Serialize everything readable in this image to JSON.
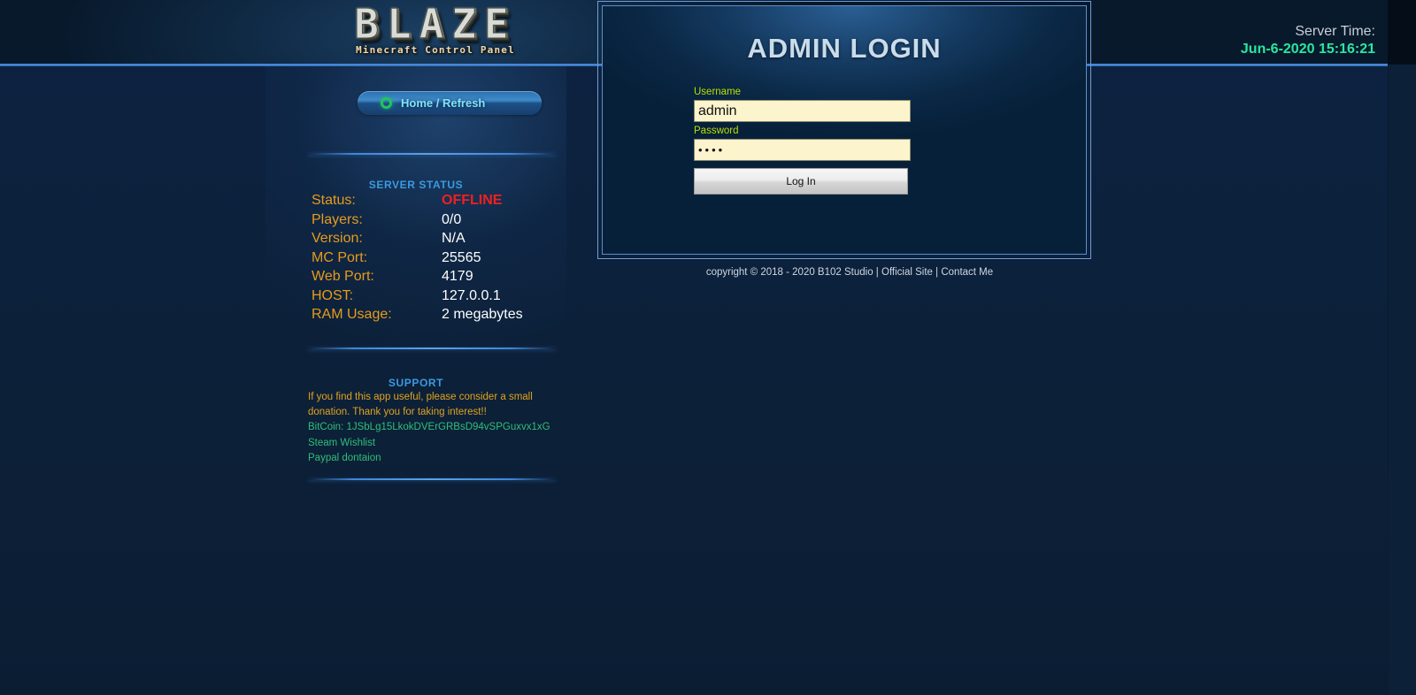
{
  "brand": {
    "logo_word": "BLAZE",
    "logo_subtitle": "Minecraft Control Panel"
  },
  "header": {
    "server_time_label": "Server Time:",
    "server_time_value": "Jun-6-2020 15:16:21"
  },
  "sidebar": {
    "nav": [
      {
        "label": "Home / Refresh",
        "icon": "green-ring-icon"
      }
    ],
    "status_section": {
      "title": "SERVER STATUS",
      "rows": [
        {
          "key": "Status:",
          "value": "OFFLINE",
          "state": "offline"
        },
        {
          "key": "Players:",
          "value": "0/0"
        },
        {
          "key": "Version:",
          "value": "N/A"
        },
        {
          "key": "MC Port:",
          "value": "25565"
        },
        {
          "key": "Web Port:",
          "value": "4179"
        },
        {
          "key": "HOST:",
          "value": "127.0.0.1"
        },
        {
          "key": "RAM Usage:",
          "value": "2 megabytes"
        }
      ]
    },
    "support_section": {
      "title": "SUPPORT",
      "note_line1": "If you find this app useful, please consider a small",
      "note_line2": "donation. Thank you for taking interest!!",
      "links": [
        {
          "label": "BitCoin: 1JSbLg15LkokDVErGRBsD94vSPGuxvx1xG"
        },
        {
          "label": "Steam Wishlist"
        },
        {
          "label": "Paypal dontaion"
        }
      ]
    }
  },
  "login": {
    "title": "ADMIN LOGIN",
    "username_label": "Username",
    "username_value": "admin",
    "username_placeholder": "",
    "password_label": "Password",
    "password_value": "••••",
    "password_placeholder": "",
    "submit_label": "Log In"
  },
  "footer": {
    "copyright": "copyright © 2018 - 2020 B102 Studio",
    "separator1": " | ",
    "official_site": "Official Site",
    "separator2": " | ",
    "contact": "Contact Me"
  },
  "colors": {
    "page_bg": "#0c2138",
    "rule_blue": "#4b8ee0",
    "accent_orange": "#e89b1c",
    "accent_green": "#2fbf7a",
    "status_offline": "#ef2020",
    "time_green": "#2ae6a0",
    "label_lime": "#b8e000",
    "input_cream": "#fcf4cc",
    "title_blue": "#3b9ae0"
  }
}
